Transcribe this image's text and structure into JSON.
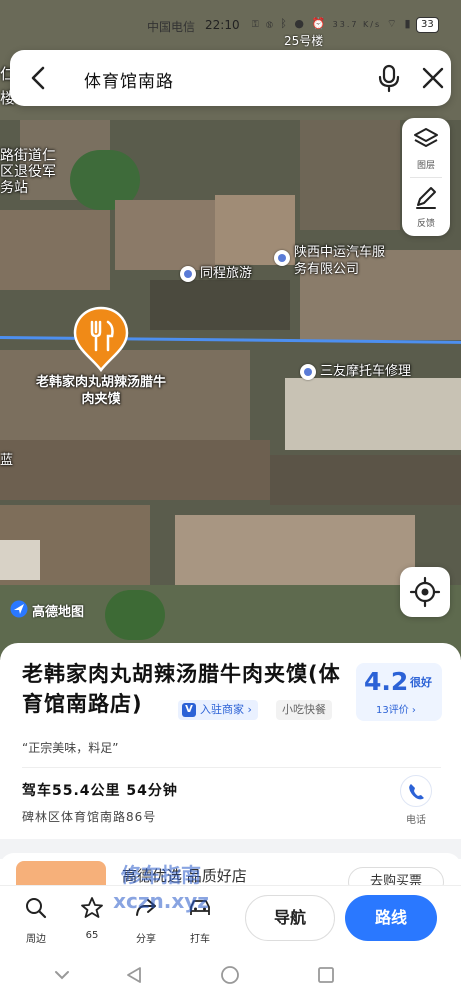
{
  "status_bar": {
    "carrier": "中国电信",
    "time": "22:10",
    "net_speed": "33.7 K/s",
    "battery": "33"
  },
  "map": {
    "building_label": "25号楼",
    "left_edge_labels": [
      "仁",
      "楼",
      "路街道仁",
      "区退役军",
      "务站",
      "蓝"
    ],
    "pois": [
      {
        "name": "同程旅游"
      },
      {
        "name": "陕西中运汽车服务有限公司"
      },
      {
        "name": "三友摩托车修理"
      }
    ],
    "pin_label": "老韩家肉丸胡辣汤腊牛肉夹馍",
    "logo_text": "高德地图",
    "tools": [
      {
        "label": "图层",
        "icon": "layers-icon"
      },
      {
        "label": "反馈",
        "icon": "edit-icon"
      }
    ]
  },
  "search": {
    "query": "体育馆南路"
  },
  "poi": {
    "name": "老韩家肉丸胡辣汤腊牛肉夹馍(体育馆南路店)",
    "tag_verified": "入驻商家",
    "tag_category": "小吃快餐",
    "rating": "4.2",
    "rating_word": "很好",
    "reviews": "13评价 ›",
    "quote": "“正宗美味，料足”",
    "drive": "驾车55.4公里  54分钟",
    "address": "碑林区体育馆南路86号",
    "phone_label": "电话"
  },
  "promo": {
    "text": "高德优选 品质好店",
    "button": "去购买票"
  },
  "actions": {
    "nearby": "周边",
    "favorite_count": "65",
    "share": "分享",
    "taxi": "打车",
    "navigate": "导航",
    "route": "路线"
  },
  "watermark": "修车指南 xczn.xyz",
  "colors": {
    "accent": "#2a78ff",
    "pin": "#f08a17",
    "rating": "#2c62d6",
    "route_line": "#4d8ff0"
  }
}
